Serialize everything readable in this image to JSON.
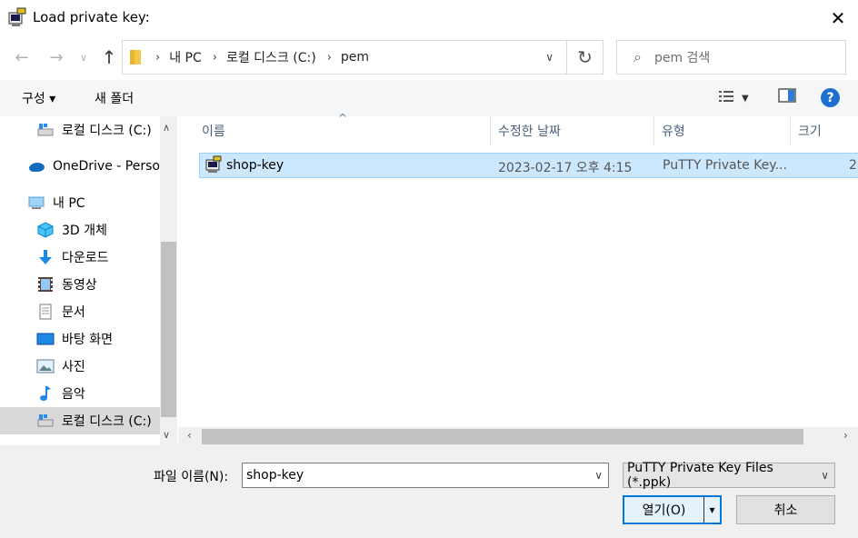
{
  "window": {
    "title": "Load private key:",
    "close_glyph": "✕"
  },
  "nav_buttons": {
    "back_glyph": "←",
    "forward_glyph": "→",
    "recent_glyph": "∨",
    "up_glyph": "↑"
  },
  "address": {
    "crumbs": [
      "내 PC",
      "로컬 디스크 (C:)",
      "pem"
    ],
    "separator": "›",
    "dropdown_glyph": "∨",
    "refresh_glyph": "↻"
  },
  "search": {
    "placeholder": "pem 검색",
    "icon_glyph": "⌕"
  },
  "toolbar": {
    "organize_label": "구성 ▾",
    "new_folder_label": "새 폴더",
    "help_label": "?"
  },
  "nav_pane": {
    "items": [
      {
        "label": "로컬 디스크 (C:)",
        "icon": "drive-icon"
      },
      {
        "label": "OneDrive - Persor",
        "icon": "cloud-icon"
      },
      {
        "label": "내 PC",
        "icon": "computer-icon"
      },
      {
        "label": "3D 개체",
        "icon": "cube-icon"
      },
      {
        "label": "다운로드",
        "icon": "download-icon"
      },
      {
        "label": "동영상",
        "icon": "video-icon"
      },
      {
        "label": "문서",
        "icon": "document-icon"
      },
      {
        "label": "바탕 화면",
        "icon": "desktop-icon"
      },
      {
        "label": "사진",
        "icon": "picture-icon"
      },
      {
        "label": "음악",
        "icon": "music-icon"
      },
      {
        "label": "로컬 디스크 (C:)",
        "icon": "drive-icon"
      }
    ],
    "selected_index": 10
  },
  "file_list": {
    "columns": [
      "이름",
      "수정한 날짜",
      "유형",
      "크기"
    ],
    "sort_glyph": "^",
    "rows": [
      {
        "name": "shop-key",
        "modified": "2023-02-17 오후 4:15",
        "type": "PuTTY Private Key...",
        "size": "2"
      }
    ]
  },
  "bottom": {
    "filename_label": "파일 이름(N):",
    "filename_value": "shop-key",
    "filetype_value": "PuTTY Private Key Files (*.ppk)",
    "open_label": "열기(O)",
    "open_dropdown_glyph": "▾",
    "cancel_label": "취소"
  },
  "colors": {
    "accent": "#0078d7",
    "selection_bg": "#cce8ff",
    "selection_border": "#99d1ff",
    "header_text": "#4c607a"
  }
}
